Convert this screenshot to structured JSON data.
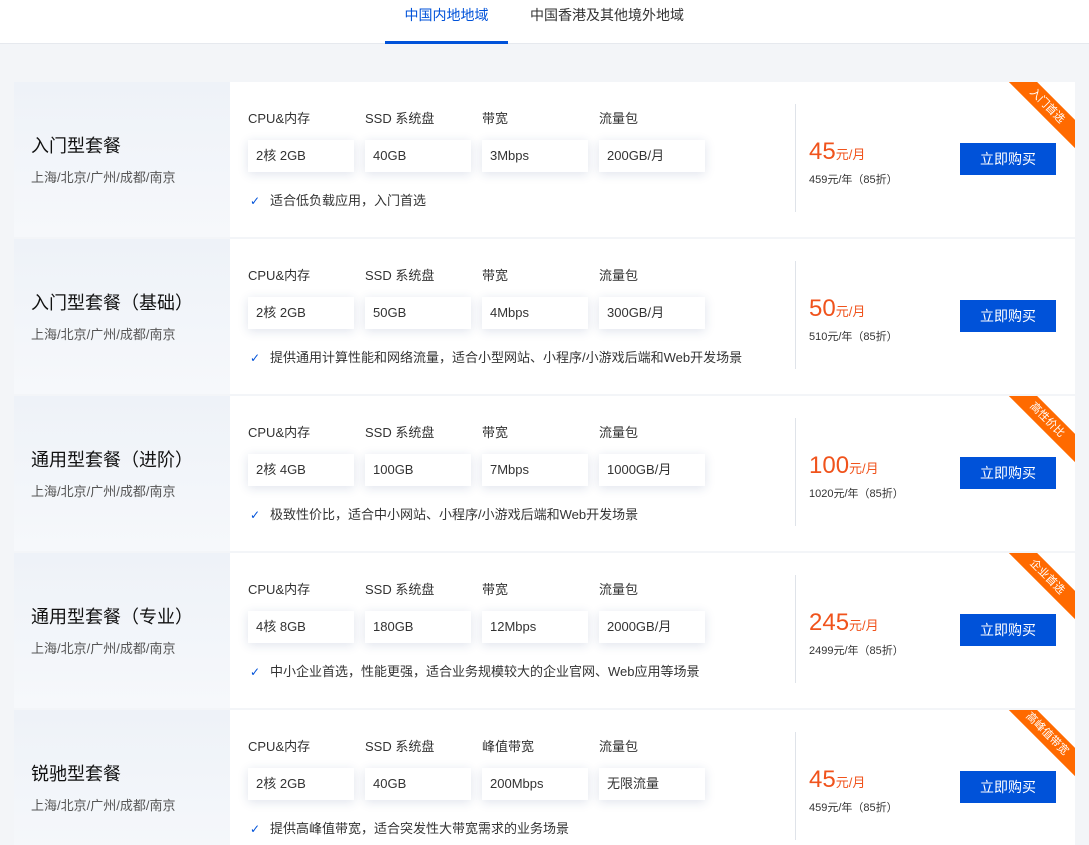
{
  "tabs": [
    {
      "label": "中国内地地域",
      "active": true
    },
    {
      "label": "中国香港及其他境外地域",
      "active": false
    }
  ],
  "labels": {
    "cpu": "CPU&内存",
    "ssd": "SSD 系统盘",
    "bw": "带宽",
    "traffic": "流量包",
    "buy": "立即购买",
    "unit": "元/月"
  },
  "plans": [
    {
      "name": "入门型套餐",
      "regions": "上海/北京/广州/成都/南京",
      "bw_label": "带宽",
      "cpu": "2核 2GB",
      "ssd": "40GB",
      "bw": "3Mbps",
      "traffic": "200GB/月",
      "feature": "适合低负载应用，入门首选",
      "price": "45",
      "yearly": "459元/年（85折）",
      "badge": "入门首选"
    },
    {
      "name": "入门型套餐（基础）",
      "regions": "上海/北京/广州/成都/南京",
      "bw_label": "带宽",
      "cpu": "2核 2GB",
      "ssd": "50GB",
      "bw": "4Mbps",
      "traffic": "300GB/月",
      "feature": "提供通用计算性能和网络流量，适合小型网站、小程序/小游戏后端和Web开发场景",
      "price": "50",
      "yearly": "510元/年（85折）",
      "badge": ""
    },
    {
      "name": "通用型套餐（进阶）",
      "regions": "上海/北京/广州/成都/南京",
      "bw_label": "带宽",
      "cpu": "2核 4GB",
      "ssd": "100GB",
      "bw": "7Mbps",
      "traffic": "1000GB/月",
      "feature": "极致性价比，适合中小网站、小程序/小游戏后端和Web开发场景",
      "price": "100",
      "yearly": "1020元/年（85折）",
      "badge": "高性价比"
    },
    {
      "name": "通用型套餐（专业）",
      "regions": "上海/北京/广州/成都/南京",
      "bw_label": "带宽",
      "cpu": "4核 8GB",
      "ssd": "180GB",
      "bw": "12Mbps",
      "traffic": "2000GB/月",
      "feature": "中小企业首选，性能更强，适合业务规模较大的企业官网、Web应用等场景",
      "price": "245",
      "yearly": "2499元/年（85折）",
      "badge": "企业首选"
    },
    {
      "name": "锐驰型套餐",
      "regions": "上海/北京/广州/成都/南京",
      "bw_label": "峰值带宽",
      "cpu": "2核 2GB",
      "ssd": "40GB",
      "bw": "200Mbps",
      "traffic": "无限流量",
      "feature": "提供高峰值带宽，适合突发性大带宽需求的业务场景",
      "price": "45",
      "yearly": "459元/年（85折）",
      "badge": "高峰值带宽"
    }
  ],
  "colors": {
    "accent": "#0052d9",
    "price": "#f0531c",
    "badge": "#ff6a00"
  }
}
